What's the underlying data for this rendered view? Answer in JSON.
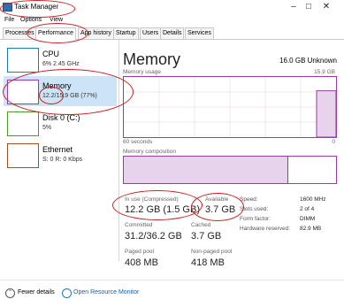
{
  "window": {
    "title": "Task Manager"
  },
  "menu": {
    "file": "File",
    "options": "Options",
    "view": "View"
  },
  "tabs": [
    "Processes",
    "Performance",
    "App history",
    "Startup",
    "Users",
    "Details",
    "Services"
  ],
  "sidebar": {
    "items": [
      {
        "name": "CPU",
        "value": "6% 2.45 GHz",
        "color": "#1a7bc4"
      },
      {
        "name": "Memory",
        "value": "12.2/15.9 GB (77%)",
        "color": "#9b3aa5"
      },
      {
        "name": "Disk 0 (C:)",
        "value": "5%",
        "color": "#4c9a2a"
      },
      {
        "name": "Ethernet",
        "value": "S: 0 R: 0 Kbps",
        "color": "#a3521d"
      }
    ]
  },
  "main": {
    "title": "Memory",
    "memory_type": "16.0 GB Unknown",
    "usage_label": "Memory usage",
    "usage_max": "15.9 GB",
    "usage_level": 0.77,
    "time_left": "60 seconds",
    "time_right": "0",
    "composition_label": "Memory composition",
    "stats": {
      "in_use_label": "In use (Compressed)",
      "in_use_value": "12.2 GB (1.5 GB)",
      "available_label": "Available",
      "available_value": "3.7 GB",
      "committed_label": "Committed",
      "committed_value": "31.2/36.2 GB",
      "cached_label": "Cached",
      "cached_value": "3.7 GB",
      "paged_label": "Paged pool",
      "paged_value": "408 MB",
      "nonpaged_label": "Non-paged pool",
      "nonpaged_value": "418 MB"
    },
    "details": {
      "speed_label": "Speed:",
      "speed_value": "1600 MHz",
      "slots_label": "Slots used:",
      "slots_value": "2 of 4",
      "form_label": "Form factor:",
      "form_value": "DIMM",
      "reserved_label": "Hardware reserved:",
      "reserved_value": "82.9 MB"
    }
  },
  "footer": {
    "fewer_details": "Fewer details",
    "open_monitor": "Open Resource Monitor"
  },
  "colors": {
    "memory_accent": "#9b3aa5",
    "selected_bg": "#cce4f7",
    "annotation_red": "#cf1f1f"
  }
}
